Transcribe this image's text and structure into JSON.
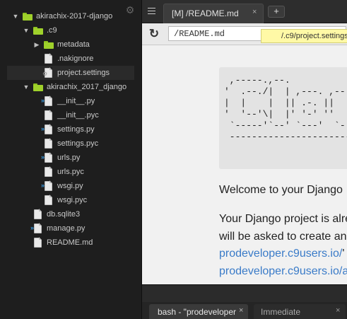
{
  "file_tree": {
    "items": [
      {
        "label": "akirachix-2017-django",
        "kind": "folder",
        "expanded": true,
        "depth": 0
      },
      {
        "label": ".c9",
        "kind": "folder",
        "expanded": true,
        "depth": 1
      },
      {
        "label": "metadata",
        "kind": "folder",
        "expanded": false,
        "depth": 2
      },
      {
        "label": ".nakignore",
        "kind": "file",
        "depth": 2
      },
      {
        "label": "project.settings",
        "kind": "settings",
        "depth": 2,
        "selected": true
      },
      {
        "label": "akirachix_2017_django",
        "kind": "folder",
        "expanded": true,
        "depth": 1
      },
      {
        "label": "__init__.py",
        "kind": "py",
        "depth": 2
      },
      {
        "label": "__init__.pyc",
        "kind": "file",
        "depth": 2
      },
      {
        "label": "settings.py",
        "kind": "py",
        "depth": 2
      },
      {
        "label": "settings.pyc",
        "kind": "file",
        "depth": 2
      },
      {
        "label": "urls.py",
        "kind": "py",
        "depth": 2
      },
      {
        "label": "urls.pyc",
        "kind": "file",
        "depth": 2
      },
      {
        "label": "wsgi.py",
        "kind": "py",
        "depth": 2
      },
      {
        "label": "wsgi.pyc",
        "kind": "file",
        "depth": 2
      },
      {
        "label": "db.sqlite3",
        "kind": "file",
        "depth": 1
      },
      {
        "label": "manage.py",
        "kind": "py",
        "depth": 1
      },
      {
        "label": "README.md",
        "kind": "file",
        "depth": 1
      }
    ]
  },
  "editor": {
    "tab_label": "[M] /README.md",
    "tab_close": "×",
    "new_tab": "+"
  },
  "browser": {
    "url_value": "/README.md",
    "tooltip": "/.c9/project.settings"
  },
  "readme": {
    "ascii_art": " ,-----.,--.\n'  .--./|  | ,---. ,--\n|  |    |  || .-. ||\n'  '--'\\|  |' '-' ''\n `-----'`--' `---'  `-\n --------------------------",
    "welcome": "Welcome to your Django",
    "line1": "Your Django project is alre",
    "line2": "will be asked to create an",
    "link1": "prodeveloper.c9users.io/",
    "link1_tail": "'",
    "link2": "prodeveloper.c9users.io/a"
  },
  "console": {
    "tabs": [
      {
        "label": "bash - \"prodeveloper",
        "close": "×",
        "active": true
      },
      {
        "label": "Immediate",
        "close": "×",
        "active": false
      }
    ]
  },
  "colors": {
    "folder": "#9fd12b",
    "link": "#3a7bc8",
    "tooltip_bg": "#fff9a6"
  },
  "icons": {
    "tree_settings": "gear-icon",
    "reload": "reload-icon",
    "pane_menu": "menu-icon"
  }
}
